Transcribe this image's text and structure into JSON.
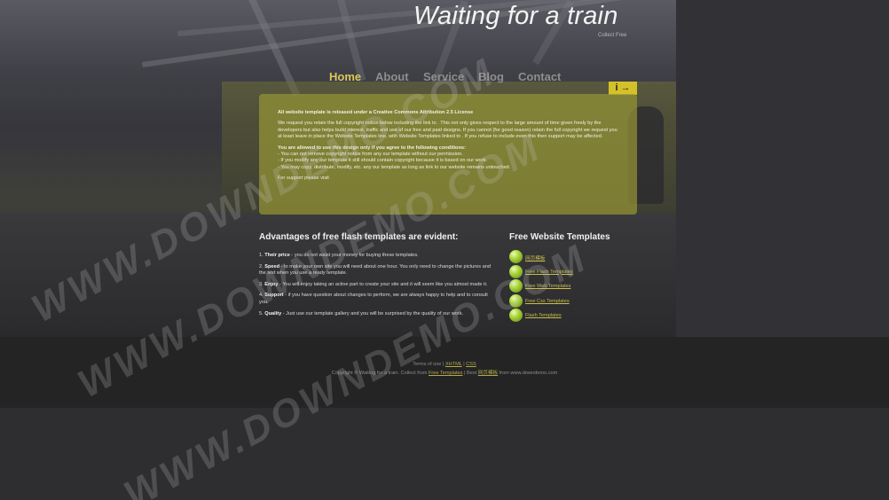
{
  "header": {
    "title": "Waiting for a train",
    "subtitle": "Collect Free"
  },
  "nav": {
    "items": [
      {
        "label": "Home",
        "active": true
      },
      {
        "label": "About",
        "active": false
      },
      {
        "label": "Service",
        "active": false
      },
      {
        "label": "Blog",
        "active": false
      },
      {
        "label": "Contact",
        "active": false
      }
    ]
  },
  "sign": {
    "label": "i →"
  },
  "notice": {
    "heading": "All website template is released under a Creative Commons Attribution 2.5 License",
    "para1": "We request you retain the full copyright notice below including the link to . This not only gives respect to the large amount of time given freely by the developers but also helps build interest, traffic and use of our free and paid designs. If you cannot (for good reason) retain the full copyright we request you at least leave in place the Website Templates line, with Website Templates linked to . If you refuse to include even this then support may be affected.",
    "conditions_heading": "You are allowed to use this design only if you agree to the following conditions:",
    "cond1": "- You can not remove copyright notice from any our template without our permission.",
    "cond2": "- If you modify any our template it still should contain copyright because it is based on our work.",
    "cond3": "- You may copy, distribute, modify, etc. any our template as long as link to our website remains untouched.",
    "support": "For support please visit"
  },
  "advantages": {
    "heading": "Advantages of free flash templates are evident:",
    "items": [
      {
        "num": "1.",
        "term": "Their price",
        "text": " - you do not waist your money for buying these templates."
      },
      {
        "num": "2.",
        "term": "Speed",
        "text": " - to make your own site you will need about one hour. You only need to change the pictures and the text when you use a ready template."
      },
      {
        "num": "3.",
        "term": "Enjoy",
        "text": " - You will enjoy taking an active part to create your site and it will seem like you almost made it."
      },
      {
        "num": "4.",
        "term": "Support",
        "text": " - if you have question about changes to perform, we are always happy to help and to consult you."
      },
      {
        "num": "5.",
        "term": "Quality",
        "text": " - Just use our template gallery and you will be surprised by the quality of our work."
      }
    ]
  },
  "free_templates": {
    "heading": "Free Website Templates",
    "links": [
      "网页模板",
      "Free Flash Templates",
      "Free Web Templates",
      "Free Css Templates",
      "Flash Templates"
    ]
  },
  "footer": {
    "links_prefix": "Terms of use | ",
    "link_xhtml": "XHTML",
    "link_sep": " | ",
    "link_css": "CSS",
    "copy_prefix": "Copyright © Waiting for a train. Collect from ",
    "copy_link1": "Free Templates",
    "copy_mid": " | Best ",
    "copy_link2": "网页模板",
    "copy_suffix": " from www.downdemo.com"
  },
  "watermark": {
    "text": "WWW.DOWNDEMO.COM"
  }
}
